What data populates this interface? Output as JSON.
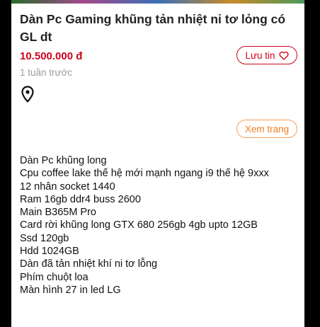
{
  "listing": {
    "title": "Dàn Pc Gaming khũng tản nhiệt ni tơ lỏng có GL dt",
    "price": "10.500.000 đ",
    "save_label": "Lưu tin",
    "save_icon": "heart-icon",
    "posted_ago": "1 tuần trước",
    "location_icon": "location-pin-icon",
    "view_page_label": "Xem trang",
    "description_lines": [
      "Dàn Pc khũng long",
      "Cpu coffee lake thế hệ mới mạnh ngang i9 thế hệ 9xxx",
      "12 nhân socket 1440",
      "Ram 16gb ddr4 buss 2600",
      "Main B365M Pro",
      "Card rời khũng long GTX 680 256gb 4gb upto 12GB",
      "Ssd 120gb",
      "Hdd 1024GB",
      "Dàn đã tản nhiệt khí ni tơ lỗng",
      "Phím chuột loa",
      "Màn hình 27 in led LG"
    ]
  },
  "colors": {
    "price": "#d0021b",
    "save_accent": "#d0021b",
    "view_page_accent": "#f27b21",
    "secondary_text": "#9b9b9b",
    "page_background": "#000000",
    "card_background": "#ffffff"
  }
}
